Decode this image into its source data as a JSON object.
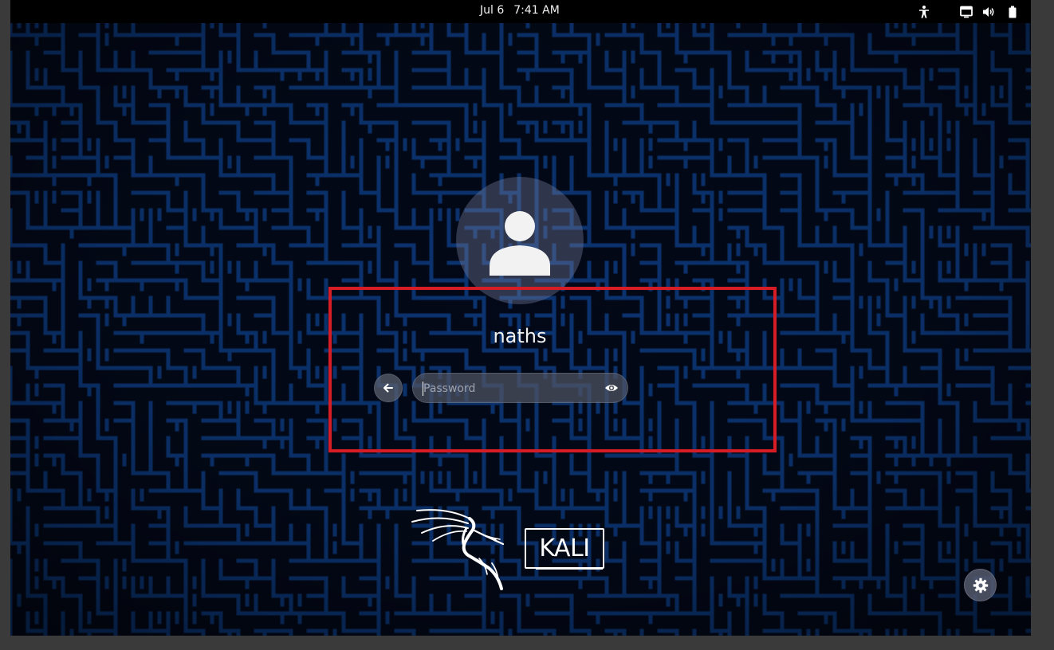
{
  "topbar": {
    "date": "Jul 6",
    "time": "7:41 AM",
    "icons": [
      "accessibility-icon",
      "display-icon",
      "volume-icon",
      "battery-icon"
    ]
  },
  "login": {
    "username": "naths",
    "password_placeholder": "Password",
    "password_value": "",
    "back_icon": "arrow-left-icon",
    "reveal_icon": "eye-icon",
    "avatar_icon": "user-silhouette-icon"
  },
  "branding": {
    "wordmark": "KALI",
    "logo_icon": "kali-dragon-icon"
  },
  "settings_icon": "gear-icon",
  "colors": {
    "wallpaper_dark": "#050a18",
    "wallpaper_maze": "#0a3a7a",
    "highlight": "#d61c24",
    "text": "#ffffff"
  }
}
